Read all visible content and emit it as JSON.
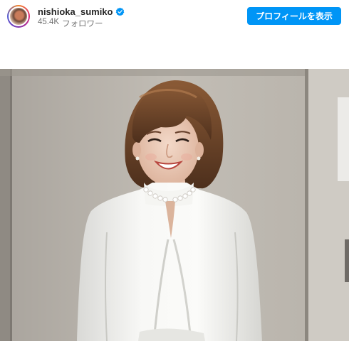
{
  "post_header": {
    "username": "nishioka_sumiko",
    "follower_count": "45.4K",
    "follower_label": "フォロワー",
    "profile_button_label": "プロフィールを表示",
    "verified": true
  },
  "colors": {
    "accent": "#0095f6",
    "verified_badge": "#0095f6",
    "username": "#262626",
    "secondary_text": "#737373"
  },
  "icons": {
    "verified": "verified-badge-icon",
    "avatar": "profile-avatar"
  }
}
